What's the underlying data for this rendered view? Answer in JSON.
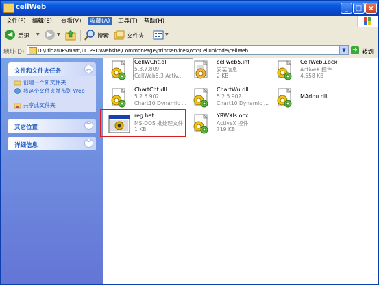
{
  "window": {
    "title": "cellWeb"
  },
  "menu": [
    {
      "label": "文件(F)"
    },
    {
      "label": "编辑(E)"
    },
    {
      "label": "查看(V)"
    },
    {
      "label": "收藏(A)",
      "active": true
    },
    {
      "label": "工具(T)"
    },
    {
      "label": "帮助(H)"
    }
  ],
  "toolbar": {
    "back_label": "后退",
    "search_label": "搜索",
    "folders_label": "文件夹"
  },
  "address": {
    "label": "地址(D)",
    "path": "D:\\ufida\\UFSmart\\TTTPRO\\Website\\CommonPage\\printservices\\ocx\\Cellunicode\\cellWeb",
    "go_label": "转到"
  },
  "left_pane": {
    "tasks_title": "文件和文件夹任务",
    "tasks": [
      {
        "label": "创建一个新文件夹"
      },
      {
        "label": "将这个文件夹发布到 Web"
      },
      {
        "label": "共享此文件夹"
      }
    ],
    "other_places_title": "其它位置",
    "details_title": "详细信息"
  },
  "files": [
    {
      "name": "CellWCht.dll",
      "line2": "5.3.7.809",
      "line3": "CellWeb5.3 Activ...",
      "icon": "dll-gear-icon"
    },
    {
      "name": "cellweb5.inf",
      "line2": "安装信息",
      "line3": "2 KB",
      "icon": "inf-settings-icon"
    },
    {
      "name": "CellWebu.ocx",
      "line2": "ActiveX 控件",
      "line3": "4,558 KB",
      "icon": "ocx-gear-icon"
    },
    {
      "name": "ChartCht.dll",
      "line2": "5.2.5.902",
      "line3": "Chart10 Dynamic ...",
      "icon": "dll-gear-icon"
    },
    {
      "name": "ChartWu.dll",
      "line2": "5.2.5.902",
      "line3": "Chart10 Dynamic ...",
      "icon": "dll-gear-icon"
    },
    {
      "name": "MAdou.dll",
      "line2": "",
      "line3": "",
      "icon": "dll-gear-icon"
    },
    {
      "name": "reg.bat",
      "line2": "MS-DOS 批处理文件",
      "line3": "1 KB",
      "icon": "batch-file-icon"
    },
    {
      "name": "YRWXls.ocx",
      "line2": "ActiveX 控件",
      "line3": "719 KB",
      "icon": "ocx-gear-icon"
    }
  ],
  "colors": {
    "titlebar": "#0a5ae0",
    "task_link": "#215dc6",
    "highlight_box": "#d81e1e"
  }
}
